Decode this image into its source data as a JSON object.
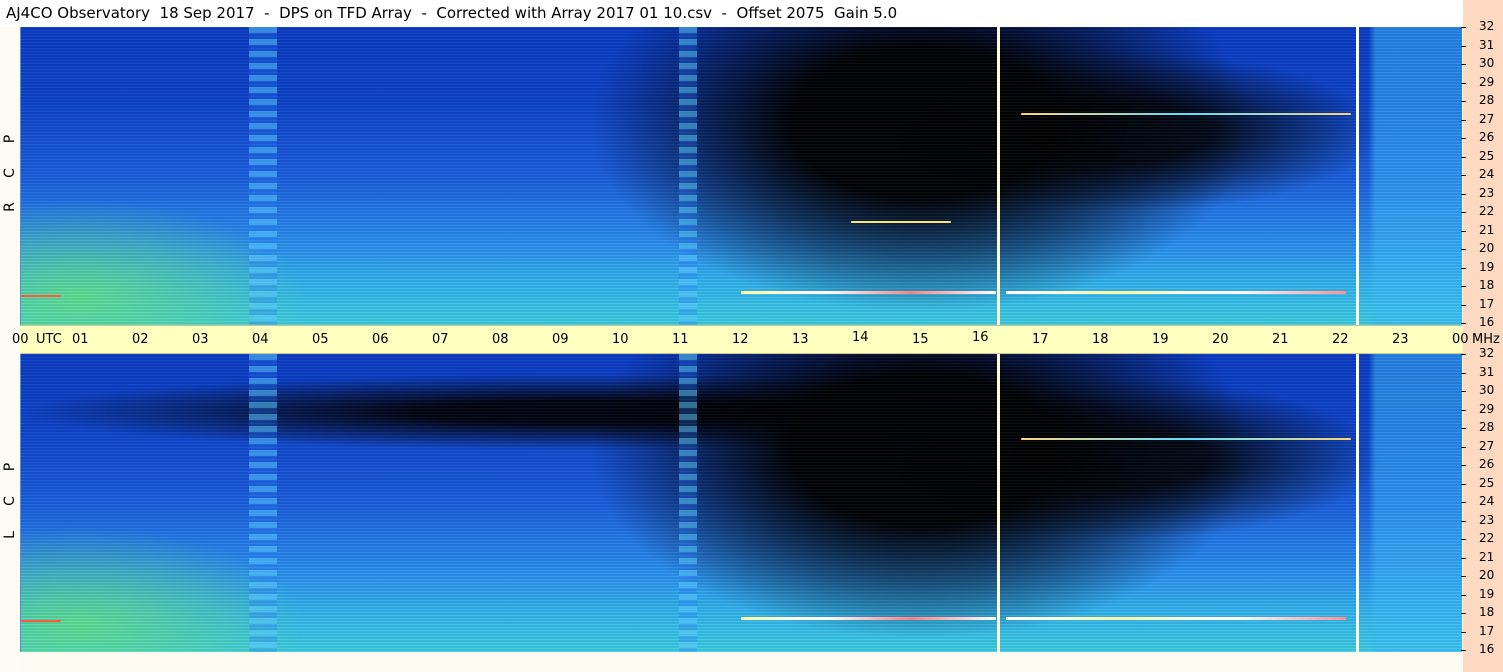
{
  "title": "AJ4CO Observatory  18 Sep 2017  -  DPS on TFD Array  -  Corrected with Array 2017 01 10.csv  -  Offset 2075  Gain 5.0",
  "time_axis": {
    "labels": [
      "00",
      "UTC",
      "01",
      "02",
      "03",
      "04",
      "05",
      "06",
      "07",
      "08",
      "09",
      "10",
      "11",
      "12",
      "13",
      "14",
      "15",
      "16",
      "17",
      "18",
      "19",
      "20",
      "21",
      "22",
      "23",
      "00",
      "MHz"
    ]
  },
  "freq_axis": {
    "labels": [
      "32",
      "31",
      "30",
      "29",
      "28",
      "27",
      "26",
      "25",
      "24",
      "23",
      "22",
      "21",
      "20",
      "19",
      "18",
      "17",
      "16"
    ]
  },
  "panels": {
    "rcp": {
      "label_letters": [
        "R",
        "C",
        "P"
      ]
    },
    "lcp": {
      "label_letters": [
        "L",
        "C",
        "P"
      ]
    }
  },
  "colors": {
    "background": "#fdfaf2",
    "time_axis_bg": "#ffffc0",
    "right_strip": "#fcd9c0",
    "spectrogram_blue": "#1654d8",
    "spectrogram_cyan": "#3fd0e6",
    "spectrogram_dark": "#000000"
  }
}
